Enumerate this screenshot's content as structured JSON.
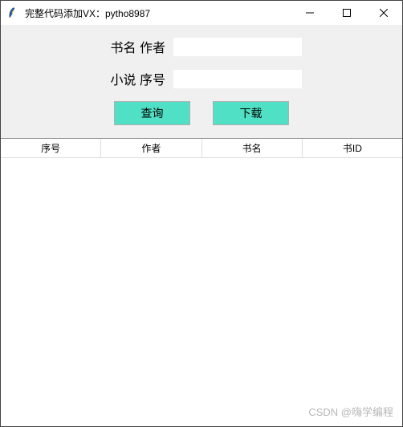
{
  "titlebar": {
    "title": "完整代码添加VX：pytho8987"
  },
  "form": {
    "row1": {
      "label": "书名 作者",
      "value": ""
    },
    "row2": {
      "label": "小说 序号",
      "value": ""
    }
  },
  "buttons": {
    "query": "查询",
    "download": "下载"
  },
  "table": {
    "headers": [
      "序号",
      "作者",
      "书名",
      "书ID"
    ],
    "rows": []
  },
  "watermark": "CSDN @嗨学编程"
}
